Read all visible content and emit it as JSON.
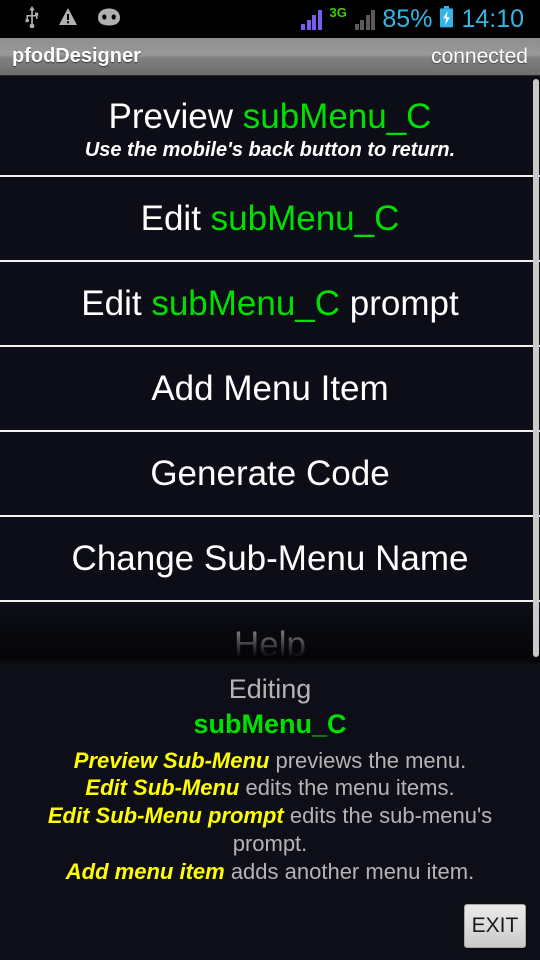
{
  "statusbar": {
    "icons": [
      "usb-icon",
      "warning-triangle-icon",
      "android-head-icon"
    ],
    "network_type": "3G",
    "battery_percent": "85%",
    "clock": "14:10",
    "accent_color": "#33b5e5",
    "network_color": "#39d100",
    "signal_bars_primary_color": "#7a5cf0",
    "signal_bars_secondary_color": "#5a5a5a"
  },
  "titlebar": {
    "app_name": "pfodDesigner",
    "connection_status": "connected"
  },
  "menu": {
    "items": [
      {
        "prefix": "Preview ",
        "highlight": "subMenu_C",
        "suffix": "",
        "subtitle": "Use the mobile's back button to return."
      },
      {
        "prefix": "Edit ",
        "highlight": "subMenu_C",
        "suffix": "",
        "subtitle": ""
      },
      {
        "prefix": "Edit ",
        "highlight": "subMenu_C",
        "suffix": " prompt",
        "subtitle": ""
      },
      {
        "prefix": "Add Menu Item",
        "highlight": "",
        "suffix": "",
        "subtitle": ""
      },
      {
        "prefix": "Generate Code",
        "highlight": "",
        "suffix": "",
        "subtitle": ""
      },
      {
        "prefix": "Change Sub-Menu Name",
        "highlight": "",
        "suffix": "",
        "subtitle": ""
      },
      {
        "prefix": "Help",
        "highlight": "",
        "suffix": "",
        "subtitle": ""
      }
    ],
    "highlight_color": "#00e000"
  },
  "info_panel": {
    "editing_label": "Editing",
    "editing_name": "subMenu_C",
    "help_lines": [
      {
        "keyword": "Preview Sub-Menu",
        "text": " previews the menu."
      },
      {
        "keyword": "Edit Sub-Menu",
        "text": " edits the menu items."
      },
      {
        "keyword": "Edit Sub-Menu prompt",
        "text": " edits the sub-menu's prompt."
      },
      {
        "keyword": "Add menu item",
        "text": " adds another menu item."
      }
    ],
    "keyword_color": "#ffff00",
    "exit_label": "EXIT"
  }
}
